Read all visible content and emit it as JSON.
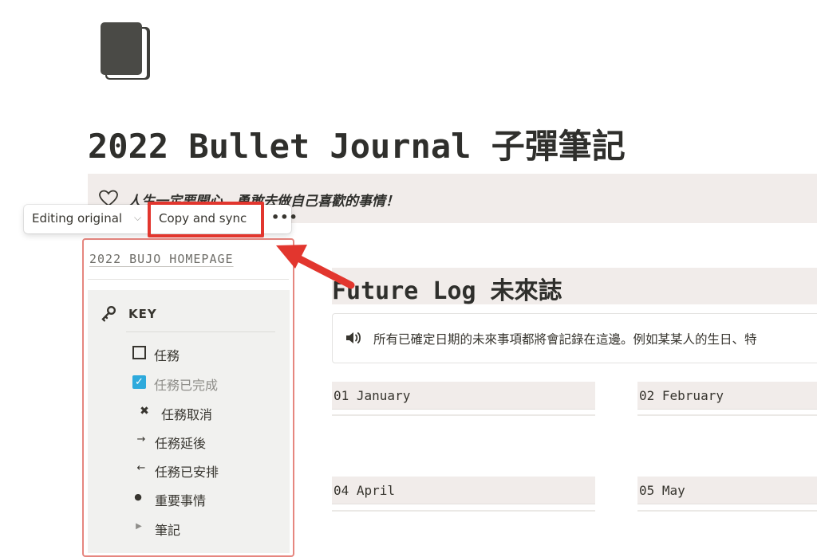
{
  "page": {
    "icon": "closed-book-icon",
    "title": "2022 Bullet Journal 子彈筆記"
  },
  "quote": {
    "icon": "heart-icon",
    "text": "人生一定要開心，勇敢去做自己喜歡的事情！"
  },
  "toolbar": {
    "editing_label": "Editing original",
    "editing_caret": "chevron-down-icon",
    "copy_sync_label": "Copy and sync",
    "more_label": "•••"
  },
  "annotation": {
    "highlight_color": "#e2362e",
    "arrow_color": "#e2362e"
  },
  "synced_block": {
    "border_color": "#e6867f",
    "homepage_link": "2022 BUJO HOMEPAGE",
    "key": {
      "icon": "key-icon",
      "title": "KEY",
      "items": [
        {
          "symbol": "unchecked-box",
          "glyph": "",
          "label": "任務"
        },
        {
          "symbol": "checked-box",
          "glyph": "✓",
          "label": "任務已完成"
        },
        {
          "symbol": "cross",
          "glyph": "✖",
          "label": "任務取消"
        },
        {
          "symbol": "arrow-right",
          "glyph": "→",
          "label": "任務延後"
        },
        {
          "symbol": "arrow-left",
          "glyph": "←",
          "label": "任務已安排"
        },
        {
          "symbol": "bullet",
          "glyph": "●",
          "label": "重要事情"
        },
        {
          "symbol": "triangle-right",
          "glyph": "▶",
          "label": "筆記"
        }
      ]
    }
  },
  "future_log": {
    "title": "Future Log 未來誌",
    "callout_icon": "speaker-icon",
    "callout_text": "所有已確定日期的未來事項都將會記錄在這邊。例如某某人的生日、特",
    "months": [
      "01 January",
      "02 February",
      "04 April",
      "05 May"
    ]
  }
}
